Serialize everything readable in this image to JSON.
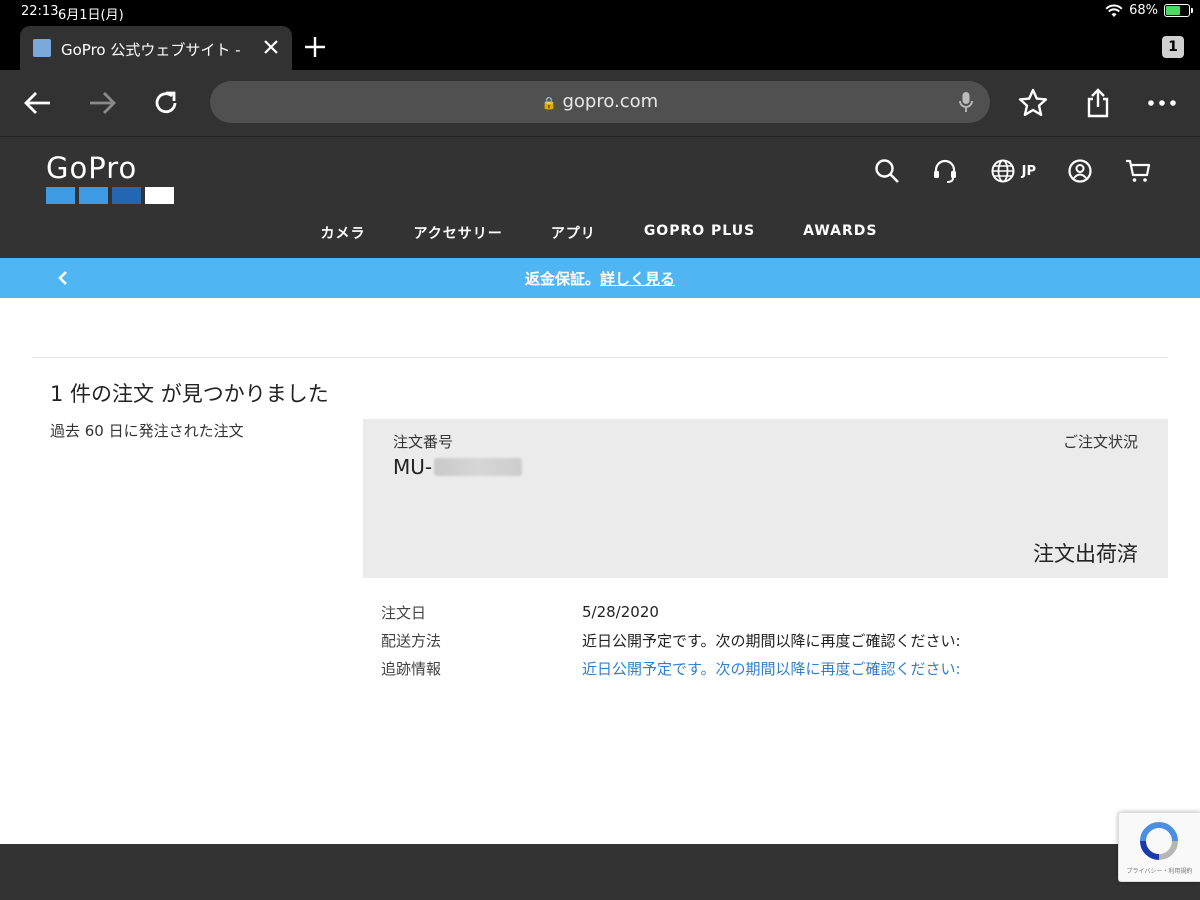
{
  "status_bar": {
    "time": "22:13",
    "date": "6月1日(月)",
    "battery": "68%",
    "battery_level": 0.68
  },
  "tab": {
    "title": "GoPro 公式ウェブサイト - ",
    "count": "1"
  },
  "address_bar": {
    "url": "gopro.com"
  },
  "site": {
    "logo_text": "GoPro",
    "logo_block_colors": [
      "#3c9be3",
      "#3c9be3",
      "#2366b3",
      "#ffffff"
    ],
    "language": "JP",
    "nav": [
      "カメラ",
      "アクセサリー",
      "アプリ",
      "GOPRO PLUS",
      "AWARDS"
    ]
  },
  "promo": {
    "text": "返金保証。",
    "link": "詳しく見る"
  },
  "orders": {
    "heading": "1 件の注文 が見つかりました",
    "subheading": "過去 60 日に発注された注文",
    "order_number_label": "注文番号",
    "order_number_prefix": "MU-",
    "status_label": "ご注文状況",
    "status_value": "注文出荷済",
    "details": [
      {
        "label": "注文日",
        "value": "5/28/2020"
      },
      {
        "label": "配送方法",
        "value": "近日公開予定です。次の期間以降に再度ご確認ください:"
      },
      {
        "label": "追跡情報",
        "value": "近日公開予定です。次の期間以降に再度ご確認ください:"
      }
    ]
  },
  "recaptcha": {
    "terms": "プライバシー・利用規約"
  },
  "colors": {
    "accent": "#50b6f3",
    "link": "#2f7fd0",
    "header": "#333333"
  }
}
